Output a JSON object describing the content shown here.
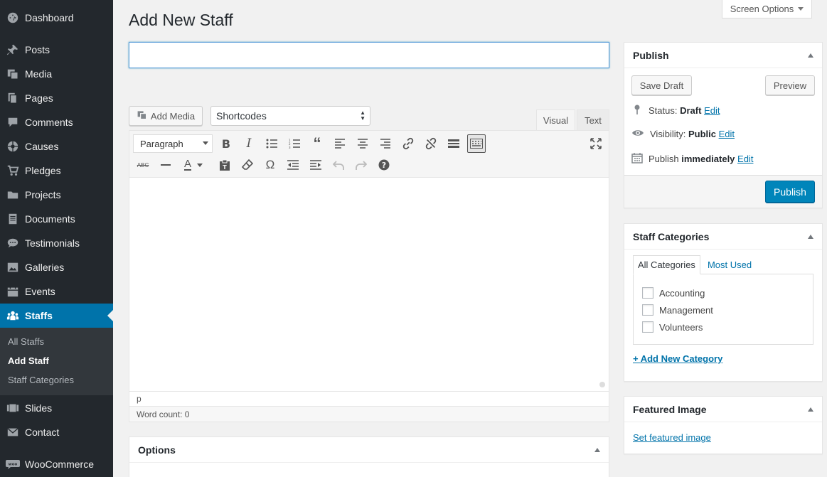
{
  "sidebar": {
    "items": [
      {
        "label": "Dashboard",
        "icon": "dashboard-icon"
      },
      {
        "label": "Posts",
        "icon": "pin-icon"
      },
      {
        "label": "Media",
        "icon": "media-icon"
      },
      {
        "label": "Pages",
        "icon": "pages-icon"
      },
      {
        "label": "Comments",
        "icon": "comment-icon"
      },
      {
        "label": "Causes",
        "icon": "causes-icon"
      },
      {
        "label": "Pledges",
        "icon": "cart-icon"
      },
      {
        "label": "Projects",
        "icon": "folder-icon"
      },
      {
        "label": "Documents",
        "icon": "document-icon"
      },
      {
        "label": "Testimonials",
        "icon": "testimonial-icon"
      },
      {
        "label": "Galleries",
        "icon": "gallery-icon"
      },
      {
        "label": "Events",
        "icon": "calendar-icon"
      },
      {
        "label": "Staffs",
        "icon": "groups-icon"
      },
      {
        "label": "Slides",
        "icon": "slides-icon"
      },
      {
        "label": "Contact",
        "icon": "email-icon"
      },
      {
        "label": "WooCommerce",
        "icon": "woo-icon"
      }
    ],
    "submenu": [
      "All Staffs",
      "Add Staff",
      "Staff Categories"
    ],
    "active_color": "#0073aa"
  },
  "screen_options": "Screen Options",
  "page_title": "Add New Staff",
  "title_input": {
    "value": "",
    "placeholder": ""
  },
  "editor": {
    "add_media": "Add Media",
    "shortcodes": "Shortcodes",
    "tab_visual": "Visual",
    "tab_text": "Text",
    "format": "Paragraph",
    "path": "p",
    "word_count": "Word count: 0"
  },
  "options": {
    "title": "Options"
  },
  "publish": {
    "title": "Publish",
    "save_draft": "Save Draft",
    "preview": "Preview",
    "status_label": "Status:",
    "status_value": "Draft",
    "visibility_label": "Visibility:",
    "visibility_value": "Public",
    "publish_label": "Publish",
    "publish_value": "immediately",
    "edit": "Edit",
    "publish_button": "Publish",
    "button_color": "#0085ba"
  },
  "categories": {
    "title": "Staff Categories",
    "tab_all": "All Categories",
    "tab_used": "Most Used",
    "items": [
      "Accounting",
      "Management",
      "Volunteers"
    ],
    "add_new": "+ Add New Category"
  },
  "featured": {
    "title": "Featured Image",
    "set_link": "Set featured image"
  }
}
